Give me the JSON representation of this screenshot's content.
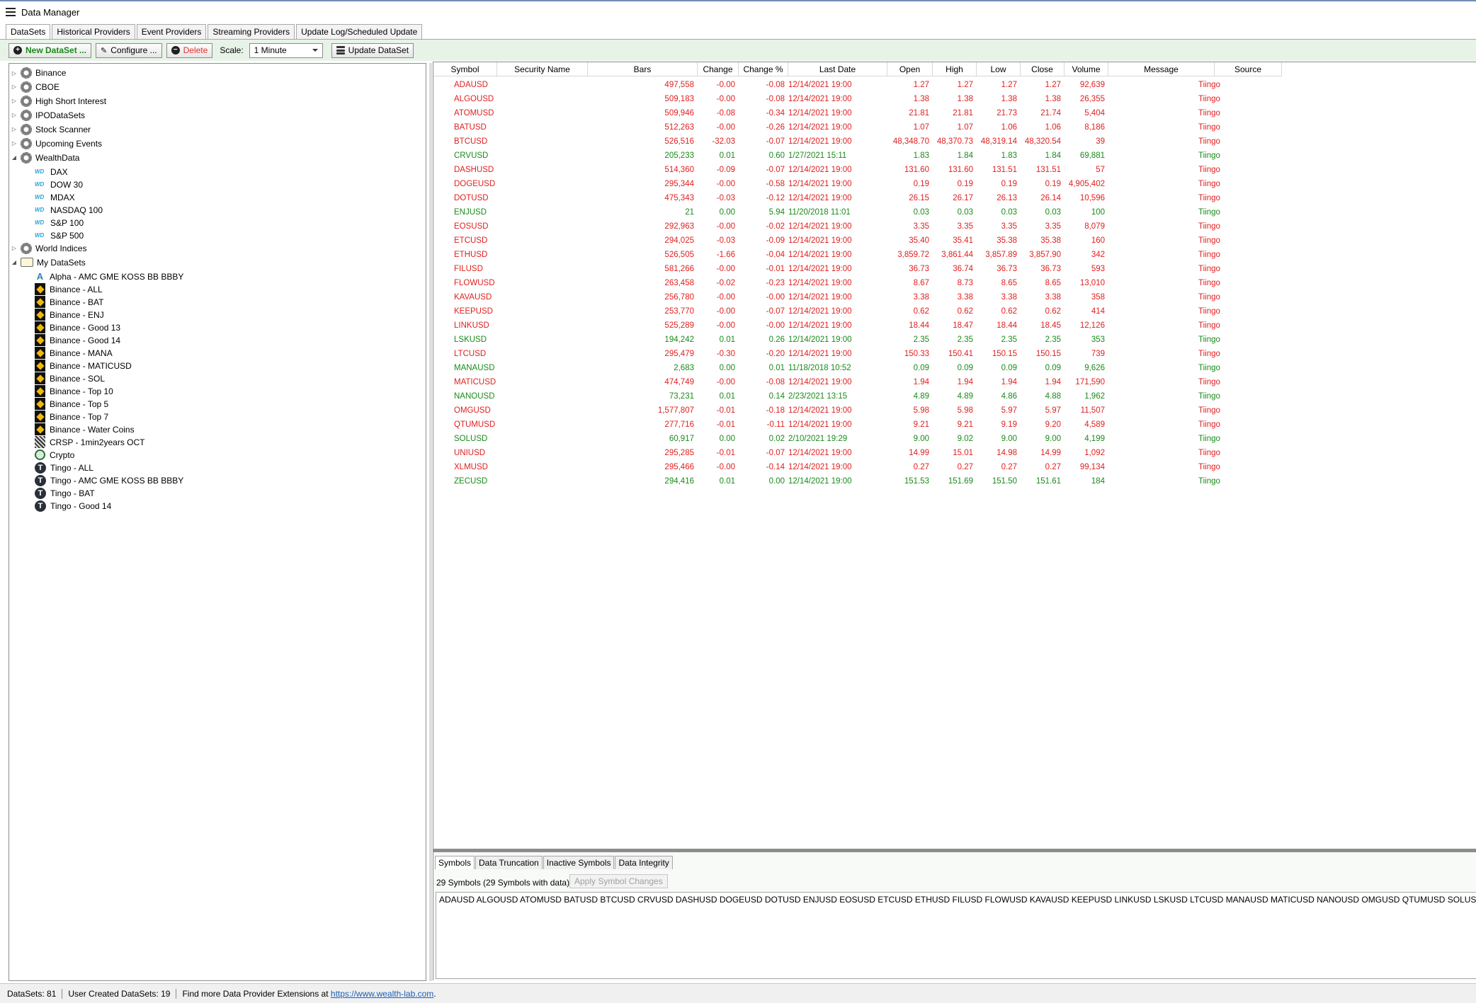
{
  "window": {
    "title": "Data Manager"
  },
  "tabs": [
    "DataSets",
    "Historical Providers",
    "Event Providers",
    "Streaming Providers",
    "Update Log/Scheduled Update"
  ],
  "toolbar": {
    "new_label": "New DataSet ...",
    "configure_label": "Configure ...",
    "delete_label": "Delete",
    "scale_label": "Scale:",
    "scale_value": "1 Minute",
    "update_label": "Update DataSet"
  },
  "tree": [
    {
      "label": "Binance",
      "icon": "gear",
      "level": 0,
      "expander": "closed"
    },
    {
      "label": "CBOE",
      "icon": "gear",
      "level": 0,
      "expander": "closed"
    },
    {
      "label": "High Short Interest",
      "icon": "gear",
      "level": 0,
      "expander": "closed"
    },
    {
      "label": "IPODataSets",
      "icon": "gear",
      "level": 0,
      "expander": "closed"
    },
    {
      "label": "Stock Scanner",
      "icon": "gear",
      "level": 0,
      "expander": "closed"
    },
    {
      "label": "Upcoming Events",
      "icon": "gear",
      "level": 0,
      "expander": "closed"
    },
    {
      "label": "WealthData",
      "icon": "gear",
      "level": 0,
      "expander": "open"
    },
    {
      "label": "DAX",
      "icon": "wd",
      "level": 1
    },
    {
      "label": "DOW 30",
      "icon": "wd",
      "level": 1
    },
    {
      "label": "MDAX",
      "icon": "wd",
      "level": 1
    },
    {
      "label": "NASDAQ 100",
      "icon": "wd",
      "level": 1
    },
    {
      "label": "S&P 100",
      "icon": "wd",
      "level": 1
    },
    {
      "label": "S&P 500",
      "icon": "wd",
      "level": 1
    },
    {
      "label": "World Indices",
      "icon": "gear",
      "level": 0,
      "expander": "closed"
    },
    {
      "label": "My DataSets",
      "icon": "folder",
      "level": 0,
      "expander": "open"
    },
    {
      "label": "Alpha - AMC GME KOSS BB BBBY",
      "icon": "alpha",
      "level": 1
    },
    {
      "label": "Binance - ALL",
      "icon": "binance",
      "level": 1
    },
    {
      "label": "Binance - BAT",
      "icon": "binance",
      "level": 1
    },
    {
      "label": "Binance - ENJ",
      "icon": "binance",
      "level": 1
    },
    {
      "label": "Binance - Good 13",
      "icon": "binance",
      "level": 1
    },
    {
      "label": "Binance - Good 14",
      "icon": "binance",
      "level": 1
    },
    {
      "label": "Binance - MANA",
      "icon": "binance",
      "level": 1
    },
    {
      "label": "Binance - MATICUSD",
      "icon": "binance",
      "level": 1
    },
    {
      "label": "Binance - SOL",
      "icon": "binance",
      "level": 1
    },
    {
      "label": "Binance - Top 10",
      "icon": "binance",
      "level": 1
    },
    {
      "label": "Binance - Top 5",
      "icon": "binance",
      "level": 1
    },
    {
      "label": "Binance - Top 7",
      "icon": "binance",
      "level": 1
    },
    {
      "label": "Binance - Water Coins",
      "icon": "binance",
      "level": 1
    },
    {
      "label": "CRSP - 1min2years OCT",
      "icon": "crsp",
      "level": 1
    },
    {
      "label": "Crypto",
      "icon": "crypto",
      "level": 1
    },
    {
      "label": "Tingo - ALL",
      "icon": "tingo",
      "level": 1
    },
    {
      "label": "Tingo - AMC GME KOSS BB BBBY",
      "icon": "tingo",
      "level": 1
    },
    {
      "label": "Tingo - BAT",
      "icon": "tingo",
      "level": 1
    },
    {
      "label": "Tingo - Good 14",
      "icon": "tingo",
      "level": 1
    }
  ],
  "grid": {
    "columns": [
      "Symbol",
      "Security Name",
      "Bars",
      "Change",
      "Change %",
      "Last Date",
      "Open",
      "High",
      "Low",
      "Close",
      "Volume",
      "Message",
      "Source"
    ],
    "colors": {
      "down": "#e02020",
      "up": "#1a8a1a"
    },
    "rows": [
      [
        "ADAUSD",
        "",
        "497,558",
        "-0.00",
        "-0.08",
        "12/14/2021 19:00",
        "1.27",
        "1.27",
        "1.27",
        "1.27",
        "92,639",
        "",
        "Tiingo",
        "down"
      ],
      [
        "ALGOUSD",
        "",
        "509,183",
        "-0.00",
        "-0.08",
        "12/14/2021 19:00",
        "1.38",
        "1.38",
        "1.38",
        "1.38",
        "26,355",
        "",
        "Tiingo",
        "down"
      ],
      [
        "ATOMUSD",
        "",
        "509,946",
        "-0.08",
        "-0.34",
        "12/14/2021 19:00",
        "21.81",
        "21.81",
        "21.73",
        "21.74",
        "5,404",
        "",
        "Tiingo",
        "down"
      ],
      [
        "BATUSD",
        "",
        "512,263",
        "-0.00",
        "-0.26",
        "12/14/2021 19:00",
        "1.07",
        "1.07",
        "1.06",
        "1.06",
        "8,186",
        "",
        "Tiingo",
        "down"
      ],
      [
        "BTCUSD",
        "",
        "526,516",
        "-32.03",
        "-0.07",
        "12/14/2021 19:00",
        "48,348.70",
        "48,370.73",
        "48,319.14",
        "48,320.54",
        "39",
        "",
        "Tiingo",
        "down"
      ],
      [
        "CRVUSD",
        "",
        "205,233",
        "0.01",
        "0.60",
        "1/27/2021 15:11",
        "1.83",
        "1.84",
        "1.83",
        "1.84",
        "69,881",
        "",
        "Tiingo",
        "up"
      ],
      [
        "DASHUSD",
        "",
        "514,360",
        "-0.09",
        "-0.07",
        "12/14/2021 19:00",
        "131.60",
        "131.60",
        "131.51",
        "131.51",
        "57",
        "",
        "Tiingo",
        "down"
      ],
      [
        "DOGEUSD",
        "",
        "295,344",
        "-0.00",
        "-0.58",
        "12/14/2021 19:00",
        "0.19",
        "0.19",
        "0.19",
        "0.19",
        "4,905,402",
        "",
        "Tiingo",
        "down"
      ],
      [
        "DOTUSD",
        "",
        "475,343",
        "-0.03",
        "-0.12",
        "12/14/2021 19:00",
        "26.15",
        "26.17",
        "26.13",
        "26.14",
        "10,596",
        "",
        "Tiingo",
        "down"
      ],
      [
        "ENJUSD",
        "",
        "21",
        "0.00",
        "5.94",
        "11/20/2018 11:01",
        "0.03",
        "0.03",
        "0.03",
        "0.03",
        "100",
        "",
        "Tiingo",
        "up"
      ],
      [
        "EOSUSD",
        "",
        "292,963",
        "-0.00",
        "-0.02",
        "12/14/2021 19:00",
        "3.35",
        "3.35",
        "3.35",
        "3.35",
        "8,079",
        "",
        "Tiingo",
        "down"
      ],
      [
        "ETCUSD",
        "",
        "294,025",
        "-0.03",
        "-0.09",
        "12/14/2021 19:00",
        "35.40",
        "35.41",
        "35.38",
        "35.38",
        "160",
        "",
        "Tiingo",
        "down"
      ],
      [
        "ETHUSD",
        "",
        "526,505",
        "-1.66",
        "-0.04",
        "12/14/2021 19:00",
        "3,859.72",
        "3,861.44",
        "3,857.89",
        "3,857.90",
        "342",
        "",
        "Tiingo",
        "down"
      ],
      [
        "FILUSD",
        "",
        "581,266",
        "-0.00",
        "-0.01",
        "12/14/2021 19:00",
        "36.73",
        "36.74",
        "36.73",
        "36.73",
        "593",
        "",
        "Tiingo",
        "down"
      ],
      [
        "FLOWUSD",
        "",
        "263,458",
        "-0.02",
        "-0.23",
        "12/14/2021 19:00",
        "8.67",
        "8.73",
        "8.65",
        "8.65",
        "13,010",
        "",
        "Tiingo",
        "down"
      ],
      [
        "KAVAUSD",
        "",
        "256,780",
        "-0.00",
        "-0.00",
        "12/14/2021 19:00",
        "3.38",
        "3.38",
        "3.38",
        "3.38",
        "358",
        "",
        "Tiingo",
        "down"
      ],
      [
        "KEEPUSD",
        "",
        "253,770",
        "-0.00",
        "-0.07",
        "12/14/2021 19:00",
        "0.62",
        "0.62",
        "0.62",
        "0.62",
        "414",
        "",
        "Tiingo",
        "down"
      ],
      [
        "LINKUSD",
        "",
        "525,289",
        "-0.00",
        "-0.00",
        "12/14/2021 19:00",
        "18.44",
        "18.47",
        "18.44",
        "18.45",
        "12,126",
        "",
        "Tiingo",
        "down"
      ],
      [
        "LSKUSD",
        "",
        "194,242",
        "0.01",
        "0.26",
        "12/14/2021 19:00",
        "2.35",
        "2.35",
        "2.35",
        "2.35",
        "353",
        "",
        "Tiingo",
        "up"
      ],
      [
        "LTCUSD",
        "",
        "295,479",
        "-0.30",
        "-0.20",
        "12/14/2021 19:00",
        "150.33",
        "150.41",
        "150.15",
        "150.15",
        "739",
        "",
        "Tiingo",
        "down"
      ],
      [
        "MANAUSD",
        "",
        "2,683",
        "0.00",
        "0.01",
        "11/18/2018 10:52",
        "0.09",
        "0.09",
        "0.09",
        "0.09",
        "9,626",
        "",
        "Tiingo",
        "up"
      ],
      [
        "MATICUSD",
        "",
        "474,749",
        "-0.00",
        "-0.08",
        "12/14/2021 19:00",
        "1.94",
        "1.94",
        "1.94",
        "1.94",
        "171,590",
        "",
        "Tiingo",
        "down"
      ],
      [
        "NANOUSD",
        "",
        "73,231",
        "0.01",
        "0.14",
        "2/23/2021 13:15",
        "4.89",
        "4.89",
        "4.86",
        "4.88",
        "1,962",
        "",
        "Tiingo",
        "up"
      ],
      [
        "OMGUSD",
        "",
        "1,577,807",
        "-0.01",
        "-0.18",
        "12/14/2021 19:00",
        "5.98",
        "5.98",
        "5.97",
        "5.97",
        "11,507",
        "",
        "Tiingo",
        "down"
      ],
      [
        "QTUMUSD",
        "",
        "277,716",
        "-0.01",
        "-0.11",
        "12/14/2021 19:00",
        "9.21",
        "9.21",
        "9.19",
        "9.20",
        "4,589",
        "",
        "Tiingo",
        "down"
      ],
      [
        "SOLUSD",
        "",
        "60,917",
        "0.00",
        "0.02",
        "2/10/2021 19:29",
        "9.00",
        "9.02",
        "9.00",
        "9.00",
        "4,199",
        "",
        "Tiingo",
        "up"
      ],
      [
        "UNIUSD",
        "",
        "295,285",
        "-0.01",
        "-0.07",
        "12/14/2021 19:00",
        "14.99",
        "15.01",
        "14.98",
        "14.99",
        "1,092",
        "",
        "Tiingo",
        "down"
      ],
      [
        "XLMUSD",
        "",
        "295,466",
        "-0.00",
        "-0.14",
        "12/14/2021 19:00",
        "0.27",
        "0.27",
        "0.27",
        "0.27",
        "99,134",
        "",
        "Tiingo",
        "down"
      ],
      [
        "ZECUSD",
        "",
        "294,416",
        "0.01",
        "0.00",
        "12/14/2021 19:00",
        "151.53",
        "151.69",
        "151.50",
        "151.61",
        "184",
        "",
        "Tiingo",
        "up"
      ]
    ]
  },
  "bottom": {
    "tabs": [
      "Symbols",
      "Data Truncation",
      "Inactive Symbols",
      "Data Integrity"
    ],
    "count_text": "29 Symbols (29 Symbols with data)",
    "apply_label": "Apply Symbol Changes",
    "symbols_text": "ADAUSD ALGOUSD ATOMUSD BATUSD BTCUSD CRVUSD DASHUSD DOGEUSD DOTUSD ENJUSD EOSUSD ETCUSD ETHUSD FILUSD FLOWUSD KAVAUSD KEEPUSD LINKUSD LSKUSD LTCUSD MANAUSD MATICUSD NANOUSD OMGUSD QTUMUSD SOLUSD UNIUSD XLMUSD ZECUSD"
  },
  "status": {
    "datasets": "DataSets: 81",
    "user_created": "User Created DataSets: 19",
    "more_text": "Find more Data Provider Extensions at",
    "link": "https://www.wealth-lab.com",
    "after_link": "."
  }
}
